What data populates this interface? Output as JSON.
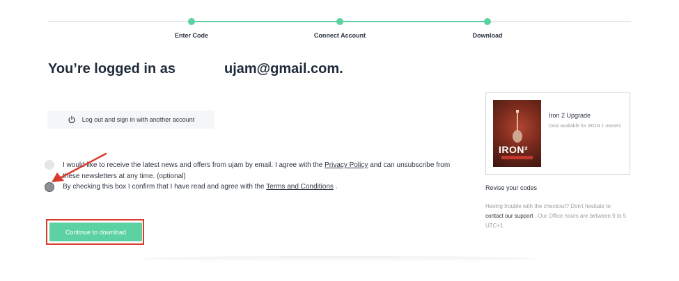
{
  "steps": [
    {
      "label": "Enter Code"
    },
    {
      "label": "Connect Account"
    },
    {
      "label": "Download"
    }
  ],
  "heading": {
    "prefix": "You’re logged in as",
    "email": "ujam@gmail.com."
  },
  "logout_button": {
    "label": "Log out and sign in with another account",
    "icon": "power-icon"
  },
  "newsletter": {
    "text_before": "I would like to receive the latest news and offers from ujam by email. I agree with the ",
    "link": "Privacy Policy",
    "text_after": " and can unsubscribe from these newsletters at any time. (optional)",
    "checked": false
  },
  "terms": {
    "text_before": "By checking this box I confirm that I have read and agree with the ",
    "link": "Terms and Conditions",
    "text_after": " .",
    "checked": true
  },
  "cta": {
    "label": "Continue to download"
  },
  "product": {
    "title": "Iron 2 Upgrade",
    "subtitle": "Deal available for IRON 1 owners",
    "cover_word": "IRON²"
  },
  "sidebar": {
    "revise_label": "Revise your codes",
    "help_before": "Having trouble with the checkout? Don't hesitate to ",
    "help_link": "contact our support",
    "help_after": " . Our Office hours are between 9 to 5 UTC+1."
  },
  "colors": {
    "accent": "#5cd1a2",
    "annotation": "#d93a2e"
  }
}
